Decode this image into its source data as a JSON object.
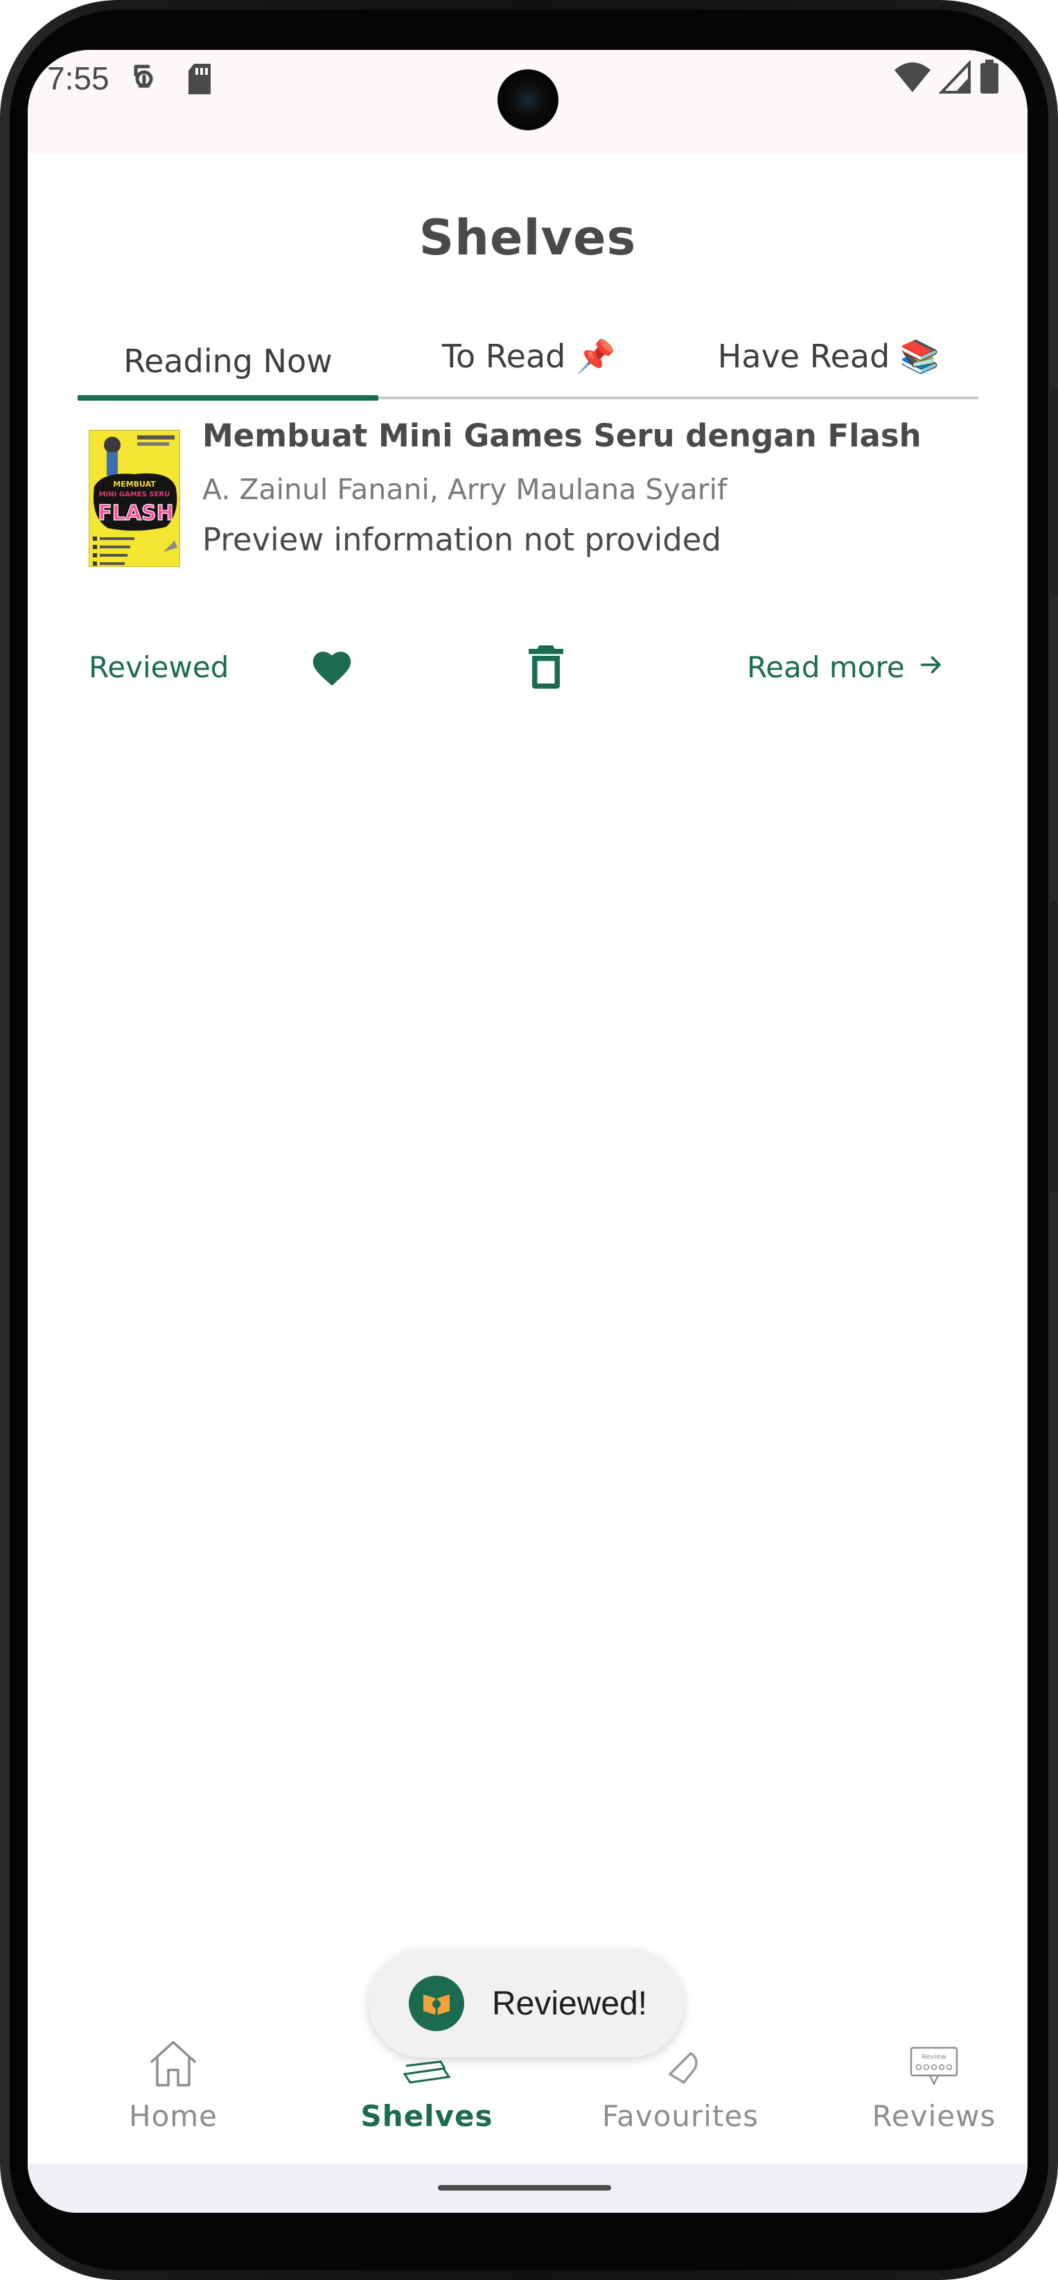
{
  "status_bar": {
    "time": "7:55",
    "left_icons": [
      "vpn-key-icon",
      "sd-card-icon"
    ],
    "right_icons": [
      "wifi-icon",
      "signal-icon",
      "battery-icon"
    ]
  },
  "header": {
    "title": "Shelves"
  },
  "tabs": [
    {
      "label": "Reading Now",
      "active": true
    },
    {
      "label": "To Read 📌",
      "active": false
    },
    {
      "label": "Have Read 📚",
      "active": false
    }
  ],
  "books": [
    {
      "title": "Membuat Mini Games Seru dengan Flash",
      "authors": "A. Zainul Fanani, Arry Maulana Syarif",
      "preview": "Preview information not provided",
      "reviewed_label": "Reviewed",
      "favorite": true,
      "read_more_label": "Read more",
      "cover": {
        "top_text": "MEMBUAT",
        "mid_text": "MINI GAMES SERU",
        "main_text": "FLASH"
      }
    }
  ],
  "toast": {
    "message": "Reviewed!"
  },
  "bottom_nav": [
    {
      "label": "Home",
      "icon": "home-icon",
      "active": false
    },
    {
      "label": "Shelves",
      "icon": "books-icon",
      "active": true
    },
    {
      "label": "Favourites",
      "icon": "heart-icon",
      "active": false
    },
    {
      "label": "Reviews",
      "icon": "review-icon",
      "active": false,
      "icon_text": "Review"
    }
  ],
  "colors": {
    "accent": "#1a6b4f",
    "title_text": "#4a4a4a",
    "muted_text": "#8e8e8e",
    "background": "#ffffff"
  }
}
